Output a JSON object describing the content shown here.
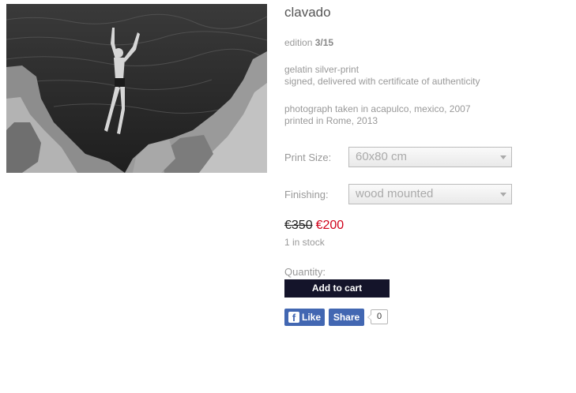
{
  "product": {
    "title": "clavado",
    "edition_prefix": "edition ",
    "edition_value": "3/15",
    "material_line1": "gelatin silver-print",
    "material_line2": "signed, delivered with certificate of authenticity",
    "photo_line1": "photograph taken in acapulco, mexico, 2007",
    "photo_line2": "printed in Rome, 2013"
  },
  "options": {
    "print_size_label": "Print Size:",
    "print_size_value": "60x80 cm",
    "finishing_label": "Finishing:",
    "finishing_value": "wood mounted"
  },
  "pricing": {
    "old_price": "€350",
    "new_price": "€200",
    "stock": "1 in stock",
    "old_color": "#222222",
    "new_color": "#d0021b"
  },
  "cart": {
    "quantity_label": "Quantity:",
    "add_to_cart": "Add to cart",
    "button_color": "#14142a"
  },
  "social": {
    "like_label": "Like",
    "share_label": "Share",
    "share_count": "0",
    "fb_icon": "facebook-f-icon",
    "fb_color": "#4267b2"
  }
}
